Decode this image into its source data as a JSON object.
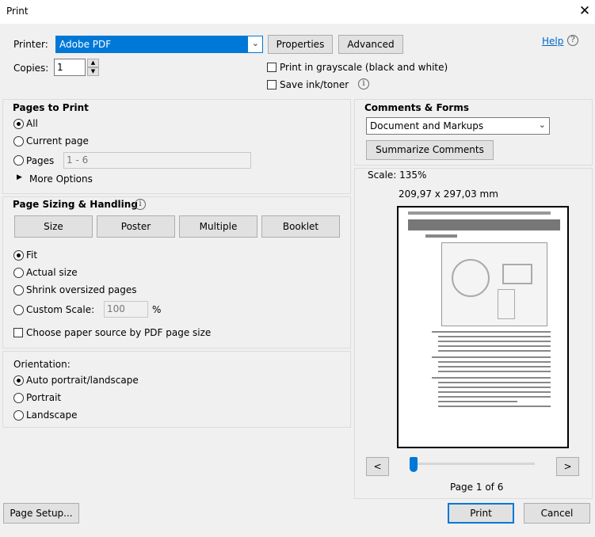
{
  "window": {
    "title": "Print",
    "close": "✕"
  },
  "help": {
    "label": "Help",
    "icon": "?"
  },
  "printer": {
    "label": "Printer:",
    "selected": "Adobe PDF",
    "properties": "Properties",
    "advanced": "Advanced"
  },
  "copies": {
    "label": "Copies:",
    "value": "1"
  },
  "options": {
    "grayscale": "Print in grayscale (black and white)",
    "save_ink": "Save ink/toner"
  },
  "pages_to_print": {
    "header": "Pages to Print",
    "all": "All",
    "current_page": "Current page",
    "pages": "Pages",
    "pages_value": "1 - 6",
    "more_options": "More Options"
  },
  "sizing": {
    "header": "Page Sizing & Handling",
    "tabs": [
      "Size",
      "Poster",
      "Multiple",
      "Booklet"
    ],
    "fit": "Fit",
    "actual_size": "Actual size",
    "shrink": "Shrink oversized pages",
    "custom_scale": "Custom Scale:",
    "custom_value": "100",
    "percent": "%",
    "paper_source": "Choose paper source by PDF page size"
  },
  "orientation": {
    "header": "Orientation:",
    "auto": "Auto portrait/landscape",
    "portrait": "Portrait",
    "landscape": "Landscape"
  },
  "comments_forms": {
    "header": "Comments & Forms",
    "selected": "Document and Markups",
    "summarize": "Summarize Comments"
  },
  "preview": {
    "scale": "Scale: 135%",
    "dimensions": "209,97 x 297,03 mm",
    "page_indicator": "Page 1 of 6",
    "prev": "<",
    "next": ">",
    "slider_fraction": 0.0
  },
  "footer": {
    "page_setup": "Page Setup...",
    "print": "Print",
    "cancel": "Cancel"
  },
  "colors": {
    "accent": "#0078d7",
    "selected_bg": "#0078d7"
  }
}
